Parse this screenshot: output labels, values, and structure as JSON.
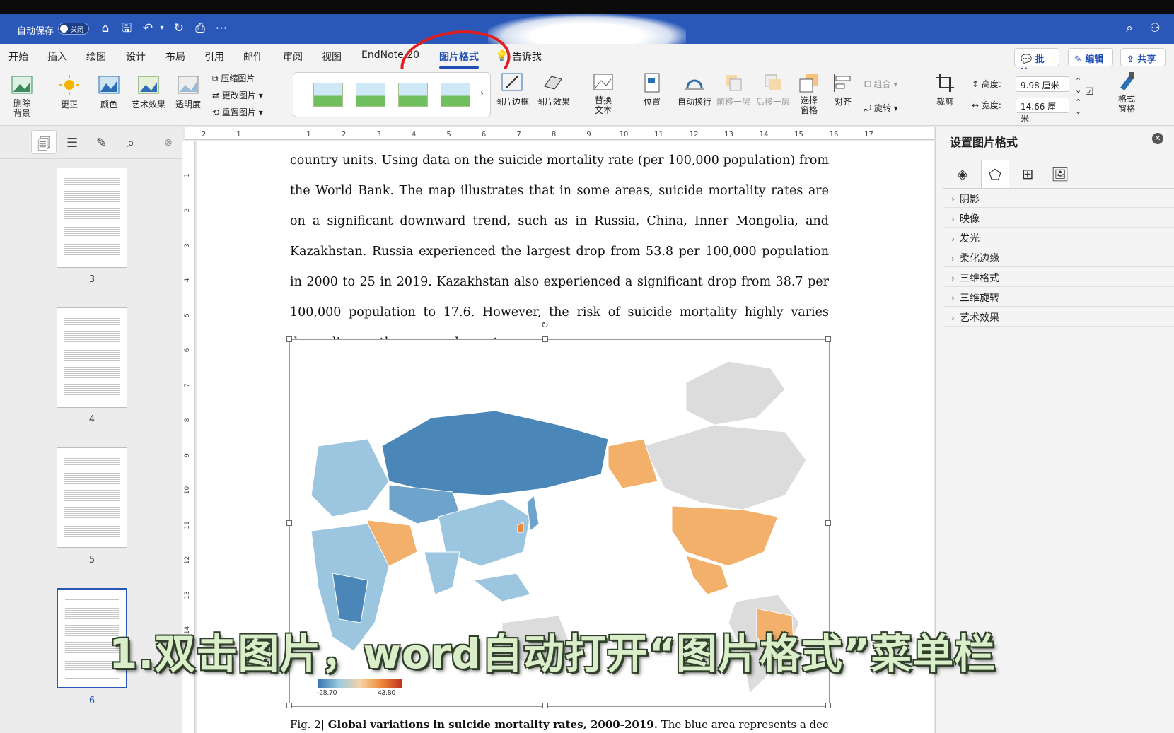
{
  "titlebar": {
    "autosave_label": "自动保存",
    "toggle_state": "关闭",
    "search_icon": "search-icon",
    "share_icon": "share-people-icon"
  },
  "menu": {
    "tabs": [
      "开始",
      "插入",
      "绘图",
      "设计",
      "布局",
      "引用",
      "邮件",
      "审阅",
      "视图",
      "EndNote 20",
      "图片格式",
      "告诉我"
    ],
    "active_tab": "图片格式",
    "right_buttons": {
      "comment": "批注",
      "edit": "编辑",
      "share": "共享"
    }
  },
  "ribbon": {
    "remove_bg": "删除\n背景",
    "corrections": "更正",
    "color": "颜色",
    "artistic": "艺术效果",
    "transparency": "透明度",
    "compress": "压缩图片",
    "change": "更改图片",
    "reset": "重置图片",
    "picture_border": "图片边框",
    "picture_effects": "图片效果",
    "alt_text": "替换\n文本",
    "position": "位置",
    "wrap": "自动换行",
    "bring_forward": "前移一层",
    "send_backward": "后移一层",
    "selection_pane": "选择\n窗格",
    "align": "对齐",
    "group": "组合",
    "rotate": "旋转",
    "crop": "裁剪",
    "height_label": "高度:",
    "height_value": "9.98 厘米",
    "width_label": "宽度:",
    "width_value": "14.66 厘米",
    "format_pane": "格式\n窗格"
  },
  "nav": {
    "pages": [
      "3",
      "4",
      "5",
      "6"
    ],
    "selected_page": "6"
  },
  "ruler": {
    "h_ticks": [
      "2",
      "1",
      "",
      "1",
      "2",
      "3",
      "4",
      "5",
      "6",
      "7",
      "8",
      "9",
      "10",
      "11",
      "12",
      "13",
      "14",
      "15",
      "16",
      "17"
    ],
    "v_ticks": [
      "1",
      "2",
      "3",
      "4",
      "5",
      "6",
      "7",
      "8",
      "9",
      "10",
      "11",
      "12",
      "13",
      "14",
      "15"
    ]
  },
  "document": {
    "paragraph": "country units. Using data on the suicide mortality rate (per 100,000 population) from the World Bank. The map illustrates that in some areas, suicide mortality rates are on a significant downward trend, such as in Russia, China, Inner Mongolia, and Kazakhstan. Russia experienced the largest drop from 53.8 per 100,000 population in 2000 to 25 in 2019. Kazakhstan also experienced a significant drop from 38.7 per 100,000 population to 17.6. However, the risk of suicide mortality highly varies depending on the area and country.",
    "caption_prefix": "Fig. 2|",
    "caption_title": "Global variations in suicide mortality rates, 2000-2019.",
    "caption_rest": "The blue area represents a decrease in",
    "legend_min": "-28.70",
    "legend_max": "43.80"
  },
  "format_pane": {
    "title": "设置图片格式",
    "sections": [
      "阴影",
      "映像",
      "发光",
      "柔化边缘",
      "三维格式",
      "三维旋转",
      "艺术效果"
    ]
  },
  "overlay": {
    "subtitle": "1.双击图片，word自动打开“图片格式”菜单栏"
  },
  "colors": {
    "title_blue": "#2a58b8",
    "active_tab": "#1f4fb5",
    "annotation_red": "#e21d1d",
    "map_decrease": "#4a86b8",
    "map_increase": "#f0a55c"
  }
}
